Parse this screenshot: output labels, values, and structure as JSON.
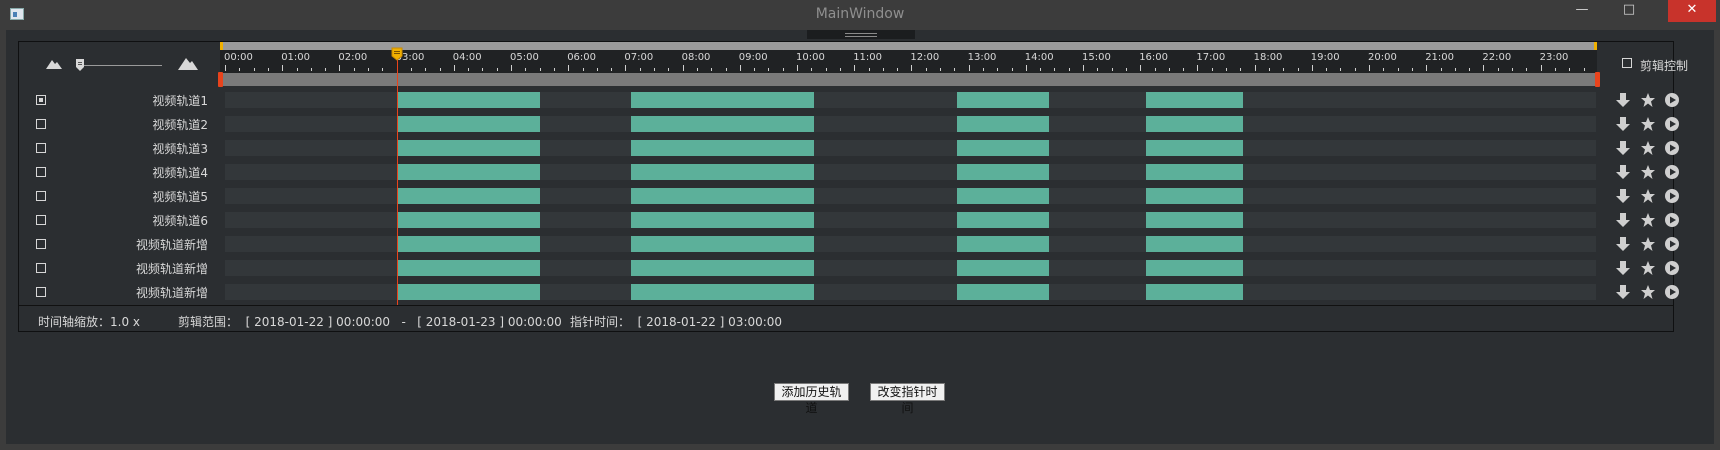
{
  "window": {
    "title": "MainWindow"
  },
  "zoom_slider": {
    "value_fraction": 0.05
  },
  "ruler": {
    "ticks": [
      "00:00",
      "01:00",
      "02:00",
      "03:00",
      "04:00",
      "05:00",
      "06:00",
      "07:00",
      "08:00",
      "09:00",
      "10:00",
      "11:00",
      "12:00",
      "13:00",
      "14:00",
      "15:00",
      "16:00",
      "17:00",
      "18:00",
      "19:00",
      "20:00",
      "21:00",
      "22:00",
      "23:00"
    ],
    "cursor_hour": 3
  },
  "clip_control": {
    "label": "剪辑控制",
    "checked": false
  },
  "tracks": [
    {
      "name": "视频轨道1",
      "checked": true
    },
    {
      "name": "视频轨道2",
      "checked": false
    },
    {
      "name": "视频轨道3",
      "checked": false
    },
    {
      "name": "视频轨道4",
      "checked": false
    },
    {
      "name": "视频轨道5",
      "checked": false
    },
    {
      "name": "视频轨道6",
      "checked": false
    },
    {
      "name": "视频轨道新增",
      "checked": false
    },
    {
      "name": "视频轨道新增",
      "checked": false
    },
    {
      "name": "视频轨道新增",
      "checked": false
    }
  ],
  "segments_hours": [
    [
      3.0,
      5.5
    ],
    [
      7.1,
      10.3
    ],
    [
      12.8,
      14.4
    ],
    [
      16.1,
      17.8
    ]
  ],
  "status": {
    "zoom": "时间轴缩放：1.0 x",
    "clip_range": "剪辑范围：  [ 2018-01-22 ] 00:00:00   -   [ 2018-01-23 ] 00:00:00",
    "pointer_time": "指针时间：  [ 2018-01-22 ] 03:00:00"
  },
  "buttons": {
    "add_history": "添加历史轨道",
    "change_pointer": "改变指针时间"
  },
  "colors": {
    "segment": "#5cb09a",
    "cursor": "#e8431c",
    "handle": "#f0b000"
  }
}
